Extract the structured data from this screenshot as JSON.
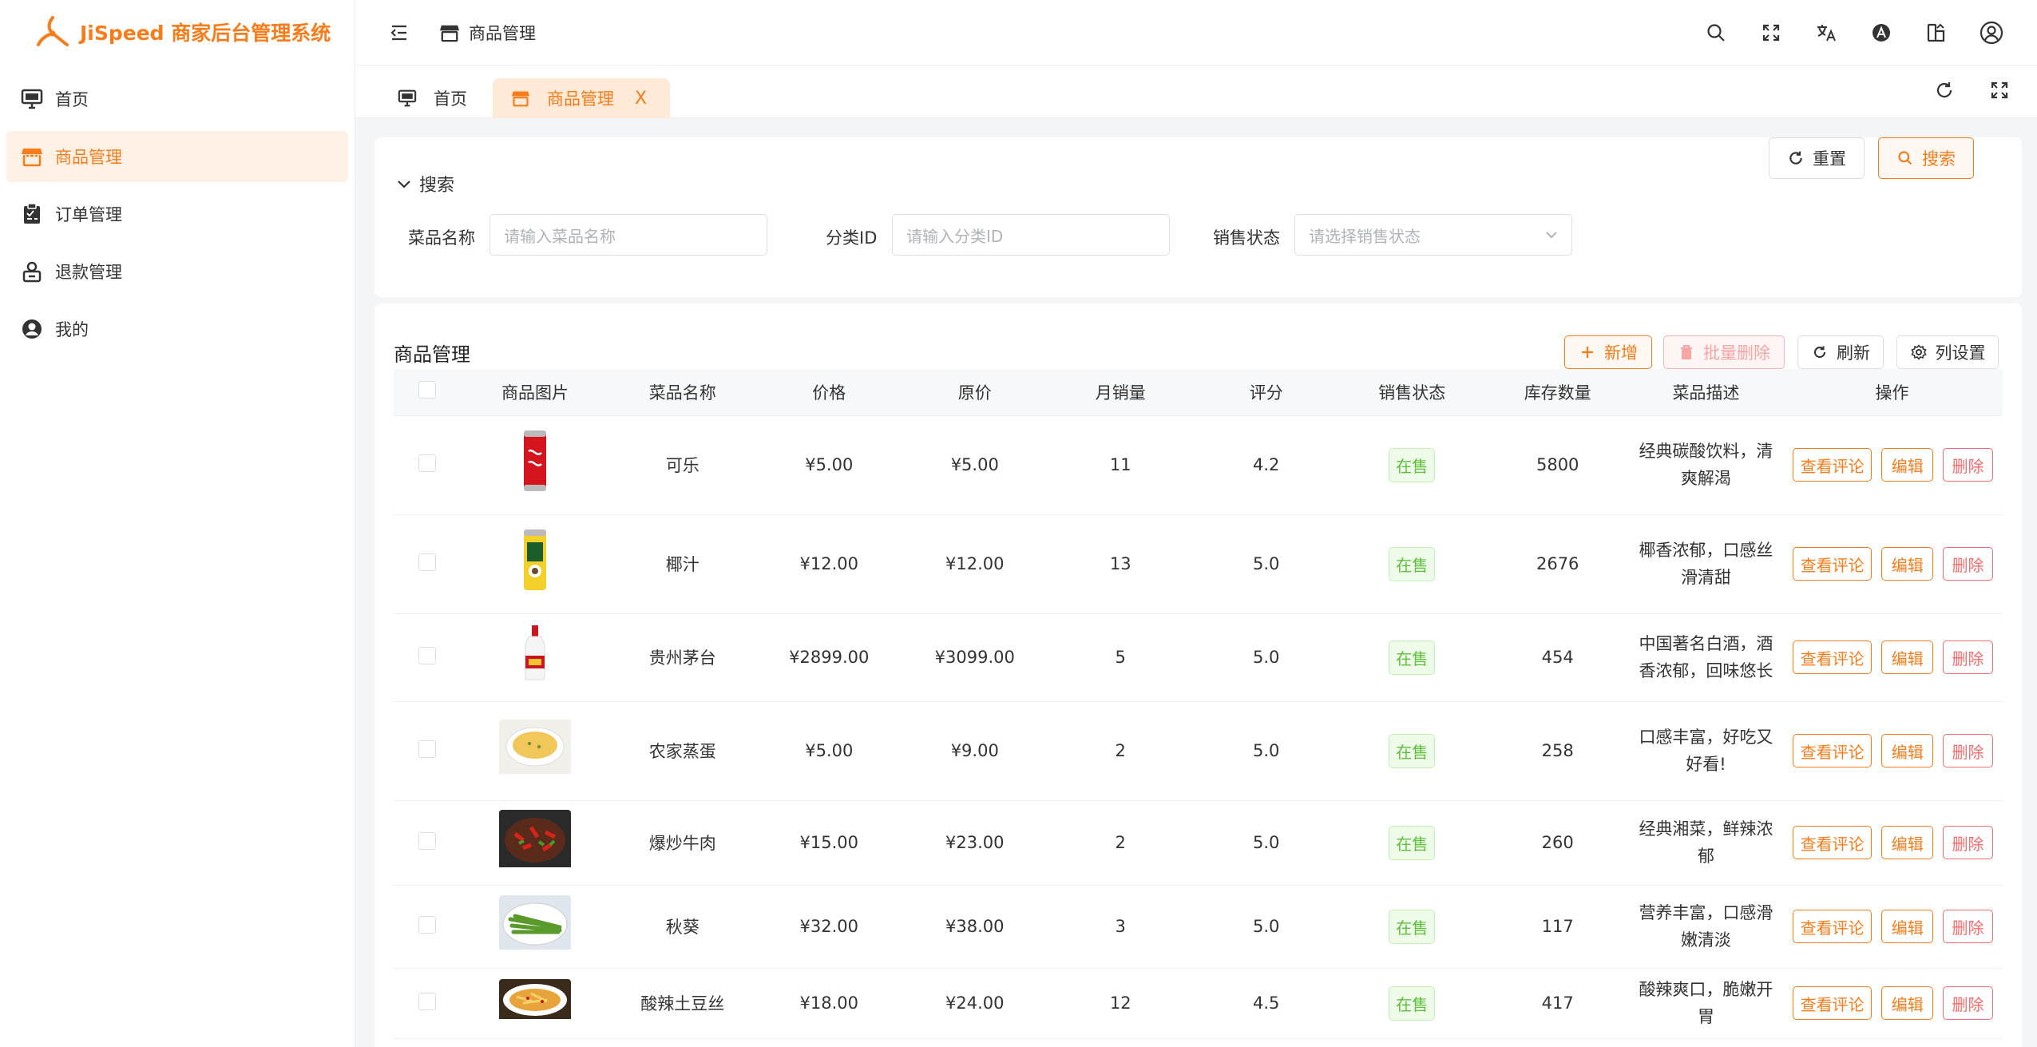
{
  "brand": {
    "title": "JiSpeed 商家后台管理系统",
    "color": "#f97c1b"
  },
  "sidebar": {
    "items": [
      {
        "label": "首页",
        "icon": "monitor-icon",
        "active": false
      },
      {
        "label": "商品管理",
        "icon": "store-icon",
        "active": true
      },
      {
        "label": "订单管理",
        "icon": "clipboard-icon",
        "active": false
      },
      {
        "label": "退款管理",
        "icon": "refund-icon",
        "active": false
      },
      {
        "label": "我的",
        "icon": "user-icon",
        "active": false
      }
    ]
  },
  "header": {
    "breadcrumb": "商品管理",
    "tools": [
      "search-icon",
      "fullscreen-icon",
      "translate-icon",
      "theme-icon",
      "layout-icon",
      "avatar-icon"
    ]
  },
  "tabs": [
    {
      "label": "首页",
      "active": false
    },
    {
      "label": "商品管理",
      "active": true,
      "close": "X"
    }
  ],
  "search": {
    "title": "搜索",
    "fields": [
      {
        "label": "菜品名称",
        "placeholder": "请输入菜品名称"
      },
      {
        "label": "分类ID",
        "placeholder": "请输入分类ID"
      },
      {
        "label": "销售状态",
        "placeholder": "请选择销售状态"
      }
    ],
    "reset_label": "重置",
    "search_label": "搜索"
  },
  "table": {
    "title": "商品管理",
    "toolbar": {
      "add": "新增",
      "batch_delete": "批量删除",
      "refresh": "刷新",
      "columns": "列设置"
    },
    "columns": [
      "商品图片",
      "菜品名称",
      "价格",
      "原价",
      "月销量",
      "评分",
      "销售状态",
      "库存数量",
      "菜品描述",
      "操作"
    ],
    "rows": [
      {
        "name": "可乐",
        "price": "¥5.00",
        "original": "¥5.00",
        "sales": "11",
        "rating": "4.2",
        "status": "在售",
        "stock": "5800",
        "desc": "经典碳酸饮料，清爽解渴",
        "image": "cola-can"
      },
      {
        "name": "椰汁",
        "price": "¥12.00",
        "original": "¥12.00",
        "sales": "13",
        "rating": "5.0",
        "status": "在售",
        "stock": "2676",
        "desc": "椰香浓郁，口感丝滑清甜",
        "image": "coconut-can"
      },
      {
        "name": "贵州茅台",
        "price": "¥2899.00",
        "original": "¥3099.00",
        "sales": "5",
        "rating": "5.0",
        "status": "在售",
        "stock": "454",
        "desc": "中国著名白酒，酒香浓郁，回味悠长",
        "image": "liquor-bottle"
      },
      {
        "name": "农家蒸蛋",
        "price": "¥5.00",
        "original": "¥9.00",
        "sales": "2",
        "rating": "5.0",
        "status": "在售",
        "stock": "258",
        "desc": "口感丰富，好吃又好看!",
        "image": "steamed-egg"
      },
      {
        "name": "爆炒牛肉",
        "price": "¥15.00",
        "original": "¥23.00",
        "sales": "2",
        "rating": "5.0",
        "status": "在售",
        "stock": "260",
        "desc": "经典湘菜，鲜辣浓郁",
        "image": "beef-dish"
      },
      {
        "name": "秋葵",
        "price": "¥32.00",
        "original": "¥38.00",
        "sales": "3",
        "rating": "5.0",
        "status": "在售",
        "stock": "117",
        "desc": "营养丰富，口感滑嫩清淡",
        "image": "okra-dish"
      },
      {
        "name": "酸辣土豆丝",
        "price": "¥18.00",
        "original": "¥24.00",
        "sales": "12",
        "rating": "4.5",
        "status": "在售",
        "stock": "417",
        "desc": "酸辣爽口，脆嫩开胃",
        "image": "potato-dish"
      }
    ],
    "actions": {
      "review": "查看评论",
      "edit": "编辑",
      "delete": "删除"
    }
  },
  "colors": {
    "accent": "#f97c1b",
    "danger": "#f56c6c",
    "success": "#5fbf3c"
  }
}
